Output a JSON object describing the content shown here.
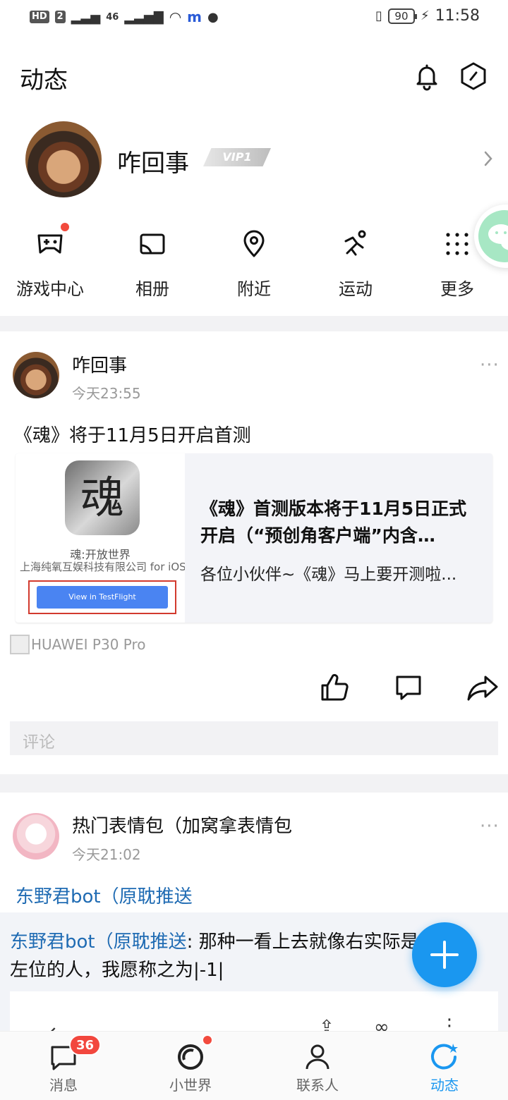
{
  "status_bar": {
    "left_label": "HD",
    "sim": "2",
    "network": "46",
    "time": "11:58",
    "battery": "90"
  },
  "header": {
    "title": "动态",
    "icons": [
      "bell-icon",
      "hexagon-settings-icon"
    ]
  },
  "profile": {
    "name": "咋回事",
    "vip_label": "VIP1"
  },
  "quick_actions": [
    {
      "label": "游戏中心",
      "icon": "gamepad-icon",
      "has_dot": true
    },
    {
      "label": "相册",
      "icon": "album-icon",
      "has_dot": false
    },
    {
      "label": "附近",
      "icon": "location-pin-icon",
      "has_dot": false
    },
    {
      "label": "运动",
      "icon": "running-icon",
      "has_dot": false
    },
    {
      "label": "更多",
      "icon": "grid-dots-icon",
      "has_dot": false
    }
  ],
  "post1": {
    "author": "咋回事",
    "time": "今天23:55",
    "more": "···",
    "text": "《魂》将于11月5日开启首测",
    "card": {
      "app_icon_char": "魂",
      "app_name": "魂:开放世界",
      "publisher": "上海纯氧互娱科技有限公司 for iOS",
      "button_label": "View in TestFlight",
      "title": "《魂》首测版本将于11月5日正式开启（“预创角客户端”内含…",
      "desc": "各位小伙伴~《魂》马上要开测啦..."
    },
    "device": "HUAWEI P30 Pro",
    "comment_placeholder": "评论"
  },
  "post2": {
    "author": "热门表情包（加窝拿表情包",
    "time": "今天21:02",
    "more": "···",
    "tag": "东野君bot（原耽推送",
    "quote_source": "东野君bot（原耽推送",
    "quote_text_line1": ":  那种一看上去就像右实际是",
    "quote_text_line2": "左位的人，我愿称之为|-1|"
  },
  "tabbar": [
    {
      "label": "消息",
      "icon": "chat-bubble-icon",
      "badge": "36",
      "active": false
    },
    {
      "label": "小世界",
      "icon": "small-world-icon",
      "badge": "",
      "active": false
    },
    {
      "label": "联系人",
      "icon": "person-icon",
      "badge": "",
      "active": false
    },
    {
      "label": "动态",
      "icon": "refresh-star-icon",
      "badge": "",
      "active": true
    }
  ],
  "colors": {
    "accent": "#1a97f0",
    "active_tab": "#1a97f0",
    "badge_red": "#f2473e",
    "link_blue": "#1f6bb3"
  }
}
